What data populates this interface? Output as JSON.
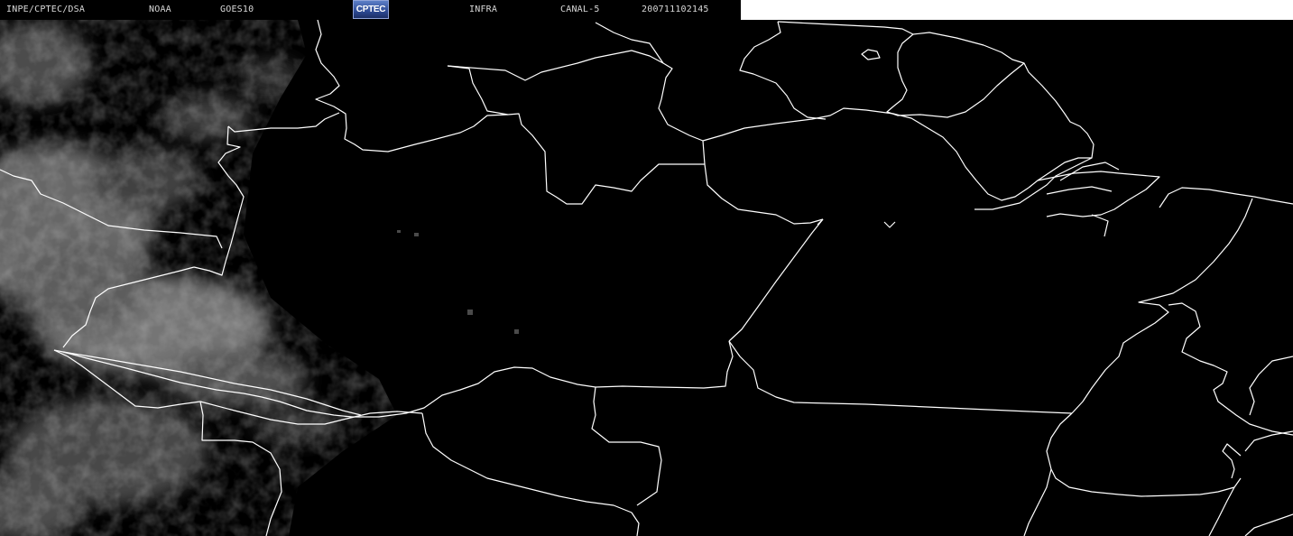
{
  "header": {
    "source": "INPE/CPTEC/DSA",
    "agency": "NOAA",
    "satellite": "GOES10",
    "logo_text": "CPTEC",
    "band": "INFRA",
    "channel": "CANAL-5",
    "timestamp": "200711102145"
  },
  "colors": {
    "background": "#000000",
    "border_lines": "#ffffff",
    "cloud": "#8a8a8a",
    "header_text": "#d8d8d8",
    "logo": "#2d4a94"
  }
}
